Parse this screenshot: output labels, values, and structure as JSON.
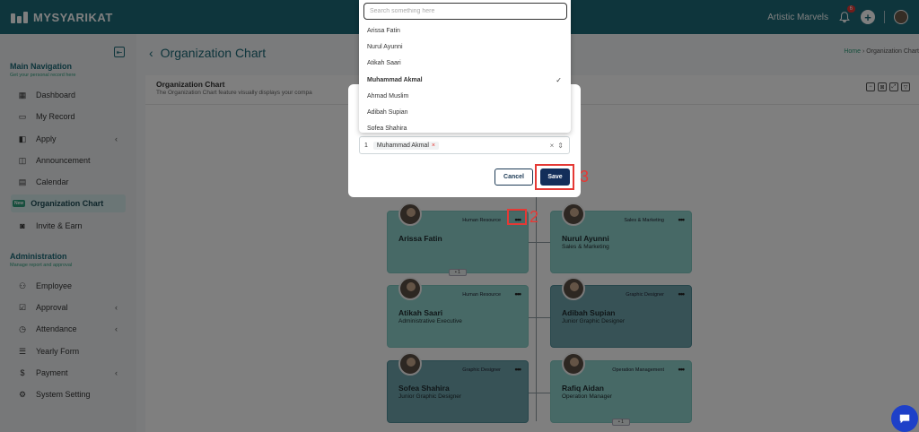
{
  "app": {
    "brand": "MYSYARIKAT",
    "user_name": "Artistic Marvels",
    "notification_count": "6"
  },
  "sidebar": {
    "main_title": "Main Navigation",
    "main_subtitle": "Get your personal record here",
    "main_items": [
      {
        "label": "Dashboard",
        "icon": "dashboard-icon"
      },
      {
        "label": "My Record",
        "icon": "folder-icon"
      },
      {
        "label": "Apply",
        "icon": "apply-icon"
      },
      {
        "label": "Announcement",
        "icon": "announcement-icon"
      },
      {
        "label": "Calendar",
        "icon": "calendar-icon"
      },
      {
        "label": "Organization Chart",
        "icon": "new-badge",
        "badge": "New"
      },
      {
        "label": "Invite & Earn",
        "icon": "gift-icon"
      }
    ],
    "admin_title": "Administration",
    "admin_subtitle": "Manage report and approval",
    "admin_items": [
      {
        "label": "Employee",
        "icon": "employee-icon"
      },
      {
        "label": "Approval",
        "icon": "approval-icon"
      },
      {
        "label": "Attendance",
        "icon": "clock-icon"
      },
      {
        "label": "Yearly Form",
        "icon": "form-icon"
      },
      {
        "label": "Payment",
        "icon": "payment-icon"
      },
      {
        "label": "System Setting",
        "icon": "gear-icon"
      }
    ]
  },
  "page": {
    "title": "Organization Chart",
    "breadcrumb_home": "Home",
    "breadcrumb_current": "Organization Chart",
    "card_title": "Organization Chart",
    "card_desc": "The Organization Chart feature visually displays your compa"
  },
  "org": [
    {
      "name": "Arissa Fatin",
      "role": "",
      "dept": "Human Resource",
      "tone": "light",
      "expand": "1"
    },
    {
      "name": "Nurul Ayunni",
      "role": "Sales & Marketing",
      "dept": "Sales & Marketing",
      "tone": "light"
    },
    {
      "name": "Atikah Saari",
      "role": "Administrative Executive",
      "dept": "Human Resource",
      "tone": "light"
    },
    {
      "name": "Adibah Supian",
      "role": "Junior Graphic Designer",
      "dept": "Graphic Designer",
      "tone": "dark"
    },
    {
      "name": "Sofea Shahira",
      "role": "Junior Graphic Designer",
      "dept": "Graphic Designer",
      "tone": "dark"
    },
    {
      "name": "Rafiq Aidan",
      "role": "Operation Manager",
      "dept": "Operation Management",
      "tone": "light",
      "expand": "1"
    }
  ],
  "modal": {
    "search_placeholder": "Search something here",
    "options": [
      "Arissa Fatin",
      "Nurul Ayunni",
      "Atikah Saari",
      "Muhammad Akmal",
      "Ahmad Muslim",
      "Adibah Supian",
      "Sofea Shahira"
    ],
    "selected_option": "Muhammad Akmal",
    "selected_index": "1",
    "selected_chip": "Muhammad Akmal",
    "cancel_label": "Cancel",
    "save_label": "Save"
  },
  "annotations": {
    "step2": "2",
    "step3": "3"
  },
  "colors": {
    "primary": "#1c6a78",
    "accent": "#2e9e7c",
    "save": "#132e5a",
    "highlight": "#e53935"
  }
}
